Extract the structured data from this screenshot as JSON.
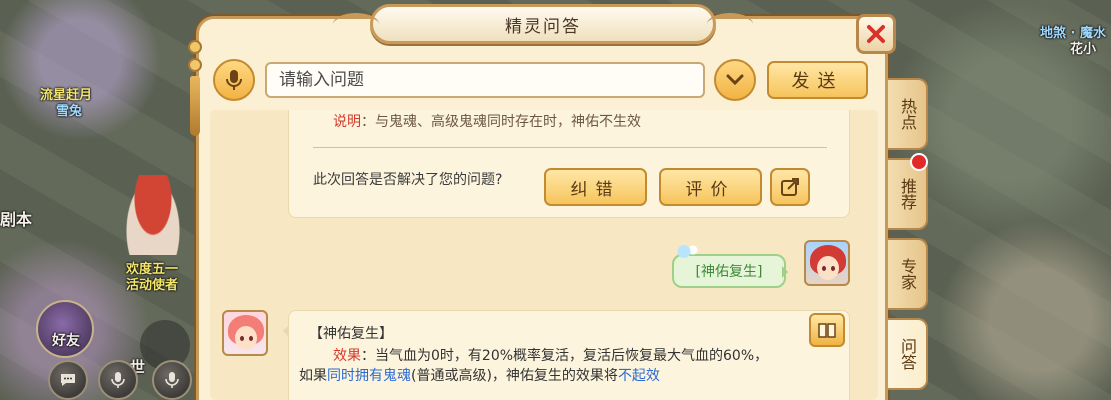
{
  "background": {
    "labels": [
      {
        "text": "流星赶月",
        "color": "yellow"
      },
      {
        "text": "雪兔",
        "color": "blue"
      },
      {
        "text": "剧本",
        "color": "white"
      },
      {
        "text": "欢度五一",
        "color": "yellow"
      },
      {
        "text": "活动使者",
        "color": "yellow"
      },
      {
        "text": "好友",
        "color": "white"
      },
      {
        "text": "世",
        "color": "white"
      },
      {
        "text": "地煞 · 魔水",
        "color": "blue"
      },
      {
        "text": "花小",
        "color": "white"
      }
    ]
  },
  "dialog": {
    "title": "精灵问答",
    "search": {
      "placeholder": "请输入问题",
      "value": ""
    },
    "send_label": "发送",
    "answer": {
      "note_key": "说明",
      "note_text": "：与鬼魂、高级鬼魂同时存在时，神佑不生效",
      "feedback_question": "此次回答是否解决了您的问题?",
      "correct_label": "纠错",
      "rate_label": "评价"
    },
    "user_message": "[神佑复生]",
    "bot_reply": {
      "title": "【神佑复生】",
      "effect_key": "效果",
      "line1_rest": "：当气血为0时，有20%概率复活，复活后恢复最大气血的60%，",
      "line2_a": "如果",
      "line2_b": "同时拥有鬼魂",
      "line2_c": "(普通或高级)，神佑复生的效果将",
      "line2_d": "不起效"
    },
    "tabs": [
      {
        "label": "热点"
      },
      {
        "label": "推荐"
      },
      {
        "label": "专家"
      },
      {
        "label": "问答"
      }
    ]
  },
  "icons": {
    "close": "close-icon",
    "mic": "microphone-icon",
    "dropdown": "chevron-down-icon",
    "share": "share-icon",
    "book": "book-icon"
  }
}
